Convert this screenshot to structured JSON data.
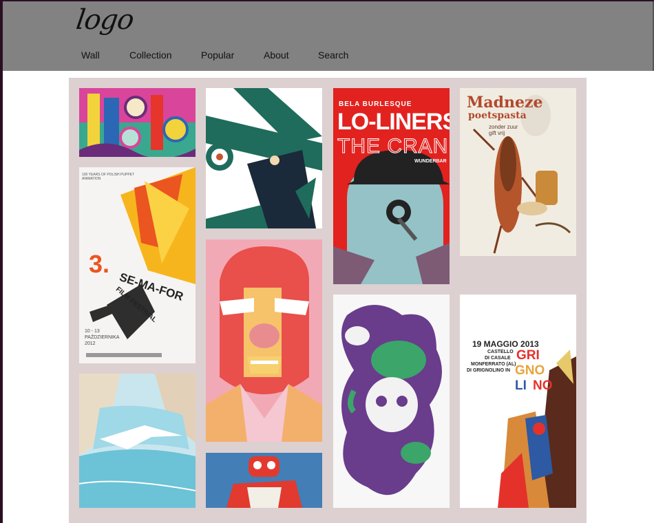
{
  "header": {
    "logo_text": "logo",
    "nav": [
      {
        "label": "Wall"
      },
      {
        "label": "Collection"
      },
      {
        "label": "Popular"
      },
      {
        "label": "About"
      },
      {
        "label": "Search"
      }
    ]
  },
  "wall": {
    "background": "#ddd0d0",
    "posters": [
      {
        "name": "typography-poster",
        "colors": [
          "#b23a8c",
          "#f2d23a",
          "#49b3a4"
        ]
      },
      {
        "name": "biplane-poster",
        "colors": [
          "#1f6c5c",
          "#ffffff",
          "#c5552e"
        ]
      },
      {
        "name": "lo-liners-poster",
        "band": "BELA BURLESQUE",
        "title": "LO-LINERS",
        "subtitle": "THE CRANK",
        "venue": "WUNDERBAR",
        "colors": [
          "#e2221f",
          "#94c2c6",
          "#222"
        ]
      },
      {
        "name": "madneze-poster",
        "title": "Madneze",
        "subtitle": "poetspasta",
        "tagline": "zonder zuur gift vrij",
        "colors": [
          "#f1ece1",
          "#b2492c"
        ]
      },
      {
        "name": "se-ma-for-poster",
        "header": "100 YEARS OF POLISH PUPPET ANIMATION",
        "number": "3.",
        "title": "SE-MA-FOR",
        "sub": "FILM FESTIVAL",
        "dates": "10 - 13 PAŹDZIERNIKA 2012",
        "colors": [
          "#f6a21b",
          "#ea5520"
        ]
      },
      {
        "name": "face-portrait-poster",
        "colors": [
          "#f0a6ae",
          "#e94f4b",
          "#f6c36a"
        ]
      },
      {
        "name": "graffiti-poster",
        "colors": [
          "#6a3c8c",
          "#3ba56a"
        ]
      },
      {
        "name": "grignolino-poster",
        "date": "19 MAGGIO 2013",
        "line1": "CASTELLO",
        "line2": "DI CASALE",
        "line3": "MONFERRATO (AL)",
        "line4": "DI GRIGNOLINO IN",
        "title_a": "GRI",
        "title_b": "GNO",
        "title_c": "LI",
        "title_d": "NO",
        "colors": [
          "#e4322b",
          "#e6c96a",
          "#2d5aa3"
        ]
      },
      {
        "name": "waterfall-poster",
        "colors": [
          "#8ed0de",
          "#ffffff"
        ]
      },
      {
        "name": "robot-poster",
        "colors": [
          "#2b6ca8",
          "#e23a2e"
        ]
      }
    ]
  }
}
